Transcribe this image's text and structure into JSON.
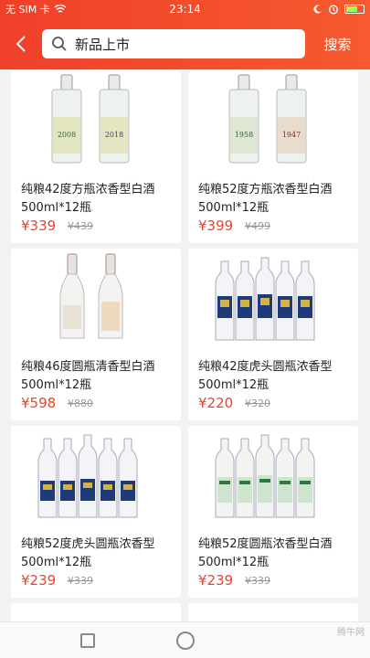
{
  "status": {
    "carrier": "无 SIM 卡",
    "time": "23:14"
  },
  "header": {
    "search_value": "新品上市",
    "search_button": "搜索"
  },
  "products": [
    {
      "name": "纯粮42度方瓶浓香型白酒500ml*12瓶",
      "price": "¥339",
      "old_price": "¥439",
      "label_texts": [
        "2008",
        "2018"
      ]
    },
    {
      "name": "纯粮52度方瓶浓香型白酒500ml*12瓶",
      "price": "¥399",
      "old_price": "¥499",
      "label_texts": [
        "1958",
        "1947"
      ]
    },
    {
      "name": "纯粮46度圆瓶清香型白酒500ml*12瓶",
      "price": "¥598",
      "old_price": "¥880"
    },
    {
      "name": "纯粮42度虎头圆瓶浓香型500ml*12瓶",
      "price": "¥220",
      "old_price": "¥320"
    },
    {
      "name": "纯粮52度虎头圆瓶浓香型500ml*12瓶",
      "price": "¥239",
      "old_price": "¥339"
    },
    {
      "name": "纯粮52度圆瓶浓香型白酒500ml*12瓶",
      "price": "¥239",
      "old_price": "¥339"
    }
  ],
  "watermark": "腾牛网"
}
